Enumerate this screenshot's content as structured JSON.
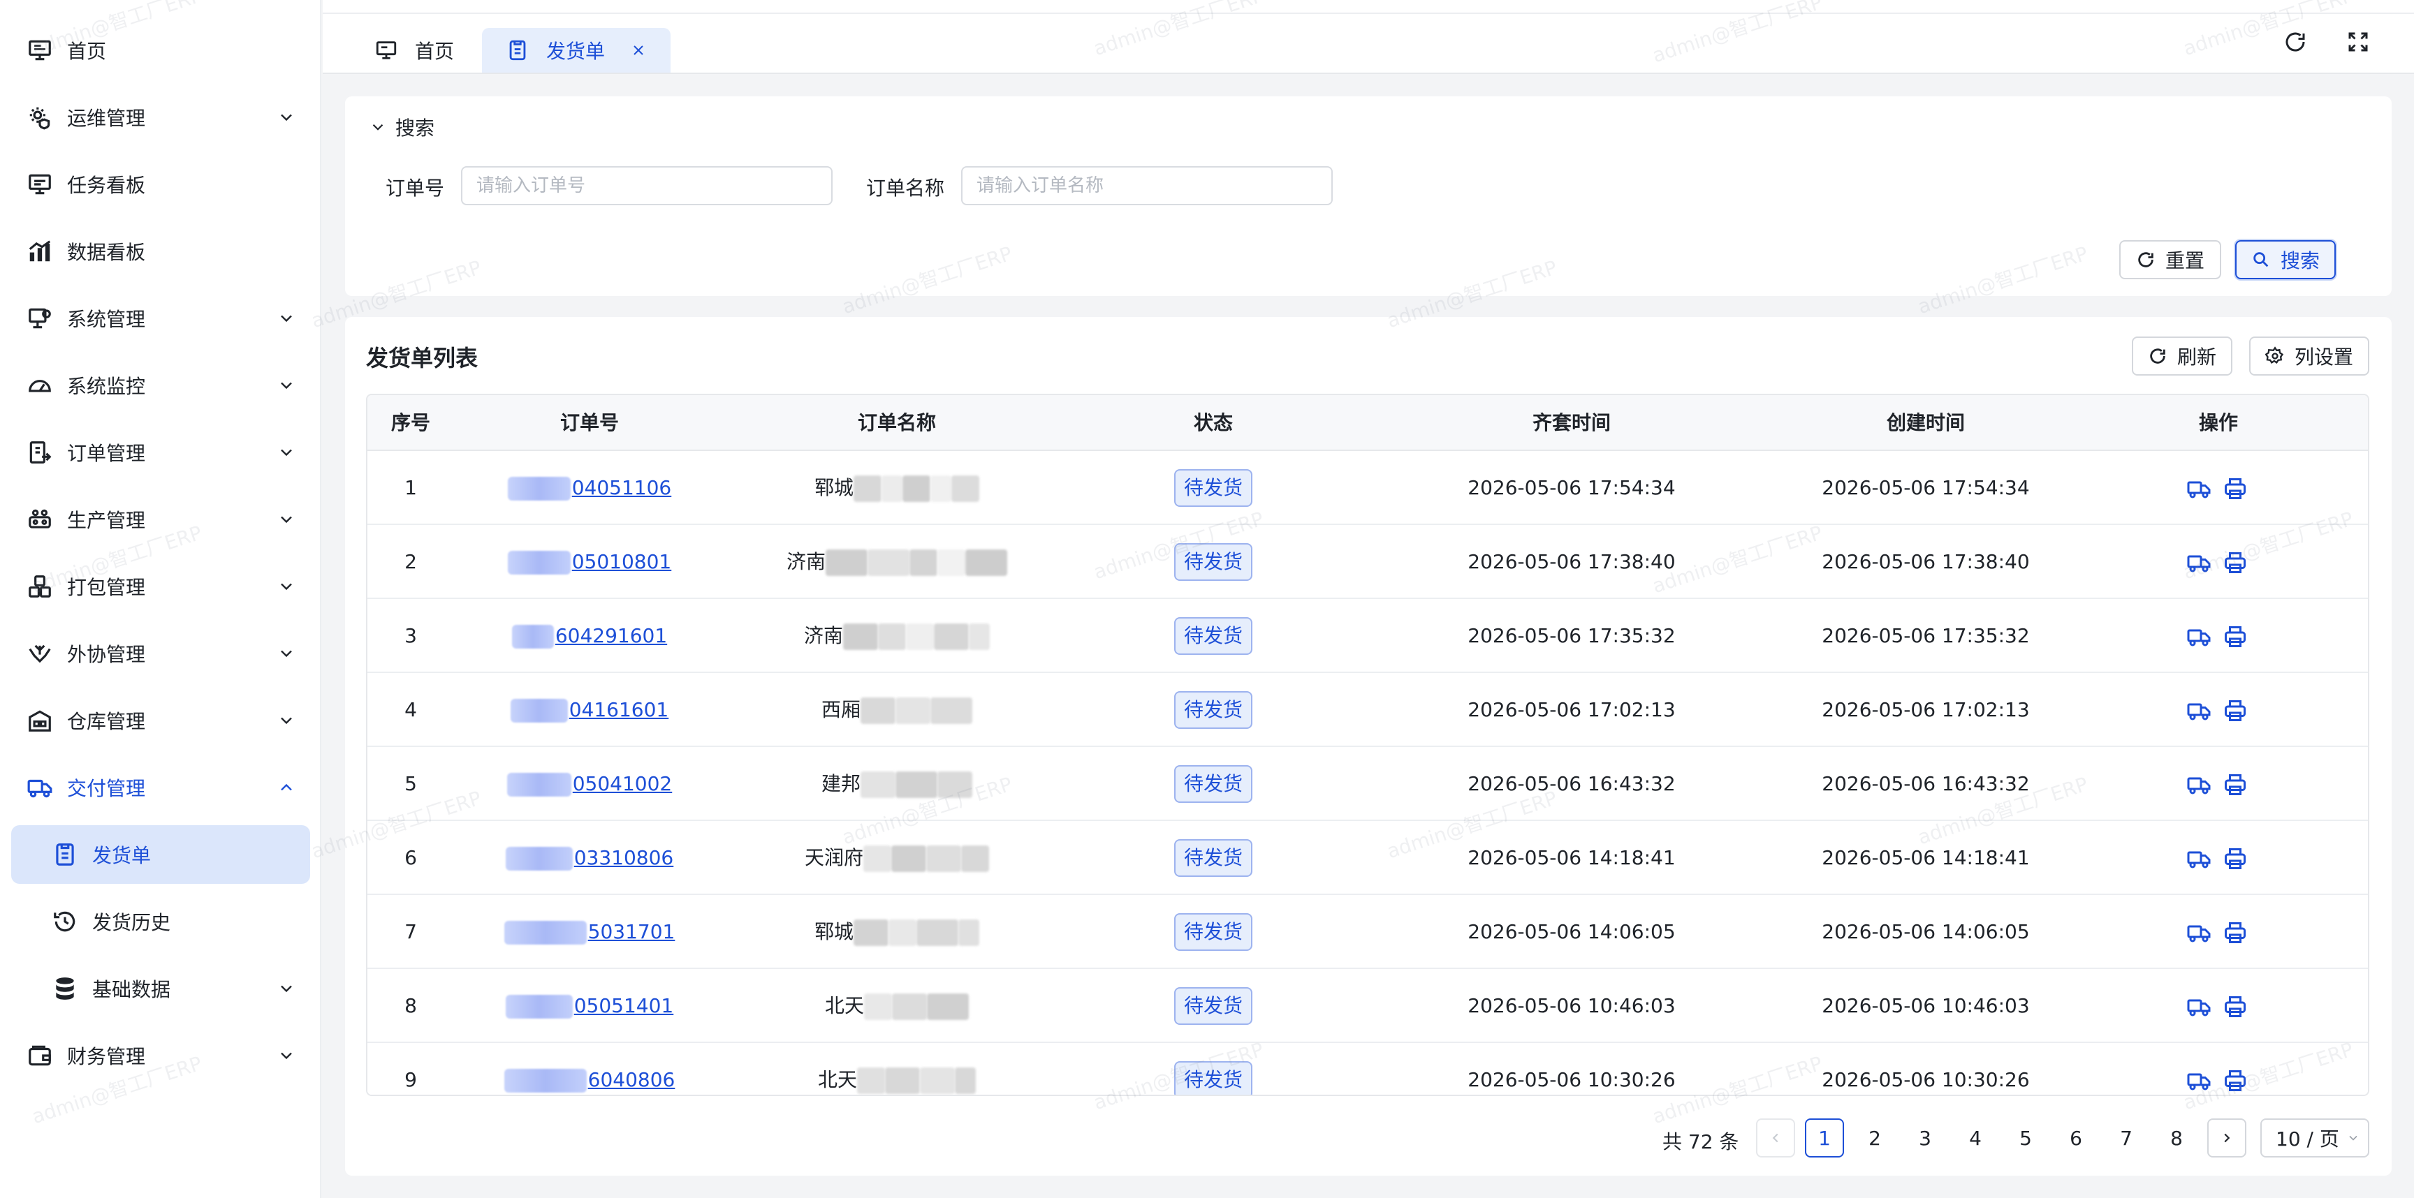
{
  "sidebar": {
    "items": [
      {
        "label": "首页",
        "icon": "monitor-icon",
        "expandable": false
      },
      {
        "label": "运维管理",
        "icon": "gear-shield-icon",
        "expandable": true
      },
      {
        "label": "任务看板",
        "icon": "dashboard-icon",
        "expandable": false
      },
      {
        "label": "数据看板",
        "icon": "bar-chart-icon",
        "expandable": false
      },
      {
        "label": "系统管理",
        "icon": "settings-monitor-icon",
        "expandable": true
      },
      {
        "label": "系统监控",
        "icon": "gauge-icon",
        "expandable": true
      },
      {
        "label": "订单管理",
        "icon": "order-icon",
        "expandable": true
      },
      {
        "label": "生产管理",
        "icon": "production-icon",
        "expandable": true
      },
      {
        "label": "打包管理",
        "icon": "package-icon",
        "expandable": true
      },
      {
        "label": "外协管理",
        "icon": "handshake-icon",
        "expandable": true
      },
      {
        "label": "仓库管理",
        "icon": "warehouse-icon",
        "expandable": true
      },
      {
        "label": "交付管理",
        "icon": "delivery-icon",
        "expandable": true,
        "expanded": true
      },
      {
        "label": "发货单",
        "icon": "document-icon",
        "sub": true,
        "active": true
      },
      {
        "label": "发货历史",
        "icon": "history-icon",
        "sub": true
      },
      {
        "label": "基础数据",
        "icon": "database-icon",
        "sub": true,
        "expandable": true
      },
      {
        "label": "财务管理",
        "icon": "wallet-icon",
        "expandable": true
      }
    ]
  },
  "tabs": [
    {
      "label": "首页",
      "icon": "monitor-icon"
    },
    {
      "label": "发货单",
      "icon": "document-icon",
      "active": true
    }
  ],
  "search": {
    "title": "搜索",
    "order_no_label": "订单号",
    "order_no_placeholder": "请输入订单号",
    "order_no_value": "",
    "order_name_label": "订单名称",
    "order_name_placeholder": "请输入订单名称",
    "order_name_value": "",
    "reset_label": "重置",
    "search_label": "搜索"
  },
  "list": {
    "title": "发货单列表",
    "refresh_label": "刷新",
    "columns_label": "列设置",
    "headers": [
      "序号",
      "订单号",
      "订单名称",
      "状态",
      "齐套时间",
      "创建时间",
      "操作"
    ],
    "rows": [
      {
        "index": "1",
        "order_no_visible": "04051106",
        "name_visible": "郓城",
        "status": "待发货",
        "kit_time": "2026-05-06 17:54:34",
        "created": "2026-05-06 17:54:34"
      },
      {
        "index": "2",
        "order_no_visible": "05010801",
        "name_visible": "济南",
        "status": "待发货",
        "kit_time": "2026-05-06 17:38:40",
        "created": "2026-05-06 17:38:40"
      },
      {
        "index": "3",
        "order_no_visible": "604291601",
        "name_visible": "济南",
        "status": "待发货",
        "kit_time": "2026-05-06 17:35:32",
        "created": "2026-05-06 17:35:32"
      },
      {
        "index": "4",
        "order_no_visible": "04161601",
        "name_visible": "西厢",
        "status": "待发货",
        "kit_time": "2026-05-06 17:02:13",
        "created": "2026-05-06 17:02:13"
      },
      {
        "index": "5",
        "order_no_visible": "05041002",
        "name_visible": "建邦",
        "status": "待发货",
        "kit_time": "2026-05-06 16:43:32",
        "created": "2026-05-06 16:43:32"
      },
      {
        "index": "6",
        "order_no_visible": "03310806",
        "name_visible": "天润府",
        "status": "待发货",
        "kit_time": "2026-05-06 14:18:41",
        "created": "2026-05-06 14:18:41"
      },
      {
        "index": "7",
        "order_no_visible": "5031701",
        "name_visible": "郓城",
        "status": "待发货",
        "kit_time": "2026-05-06 14:06:05",
        "created": "2026-05-06 14:06:05"
      },
      {
        "index": "8",
        "order_no_visible": "05051401",
        "name_visible": "北天",
        "status": "待发货",
        "kit_time": "2026-05-06 10:46:03",
        "created": "2026-05-06 10:46:03"
      },
      {
        "index": "9",
        "order_no_visible": "6040806",
        "name_visible": "北天",
        "status": "待发货",
        "kit_time": "2026-05-06 10:30:26",
        "created": "2026-05-06 10:30:26"
      }
    ]
  },
  "pagination": {
    "total_text": "共 72 条",
    "pages": [
      "1",
      "2",
      "3",
      "4",
      "5",
      "6",
      "7",
      "8"
    ],
    "current": "1",
    "page_size": "10 / 页"
  },
  "watermark": "admin@智工厂ERP",
  "colors": {
    "accent": "#1d4fd7",
    "active_bg": "#dbe6fb",
    "status_bg": "#e6eefc"
  }
}
